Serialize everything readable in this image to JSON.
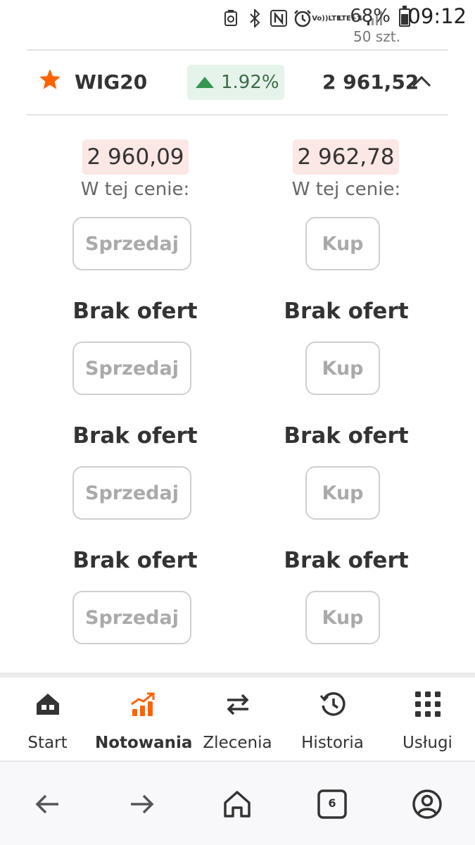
{
  "status_bar": {
    "battery_percent": "68%",
    "time": "09:12",
    "network_label_top": "Vo))",
    "network_label_bottom": "LTE",
    "data_label_top": "LTE+",
    "data_label_bottom": "⇅"
  },
  "partial_top_text": "50 szt.",
  "instrument": {
    "name": "WIG20",
    "change": "1.92%",
    "change_direction": "up",
    "price": "2 961,52",
    "favorite": true
  },
  "order_book": {
    "sell_price": "2 960,09",
    "buy_price": "2 962,78",
    "in_price_label": "W tej cenie:",
    "sell_label": "Sprzedaj",
    "buy_label": "Kup",
    "no_offers_label": "Brak ofert"
  },
  "bottom_nav": {
    "items": [
      {
        "label": "Start",
        "icon": "home-icon",
        "active": false
      },
      {
        "label": "Notowania",
        "icon": "chart-trend-icon",
        "active": true
      },
      {
        "label": "Zlecenia",
        "icon": "transfer-arrows-icon",
        "active": false
      },
      {
        "label": "Historia",
        "icon": "history-icon",
        "active": false
      },
      {
        "label": "Usługi",
        "icon": "grid-icon",
        "active": false
      }
    ]
  },
  "browser_bar": {
    "tabs_count": "6"
  },
  "colors": {
    "brand_orange": "#ff6200",
    "positive_green": "#349651",
    "positive_bg": "#e6f3ea",
    "price_bg": "#fbe7e3"
  }
}
